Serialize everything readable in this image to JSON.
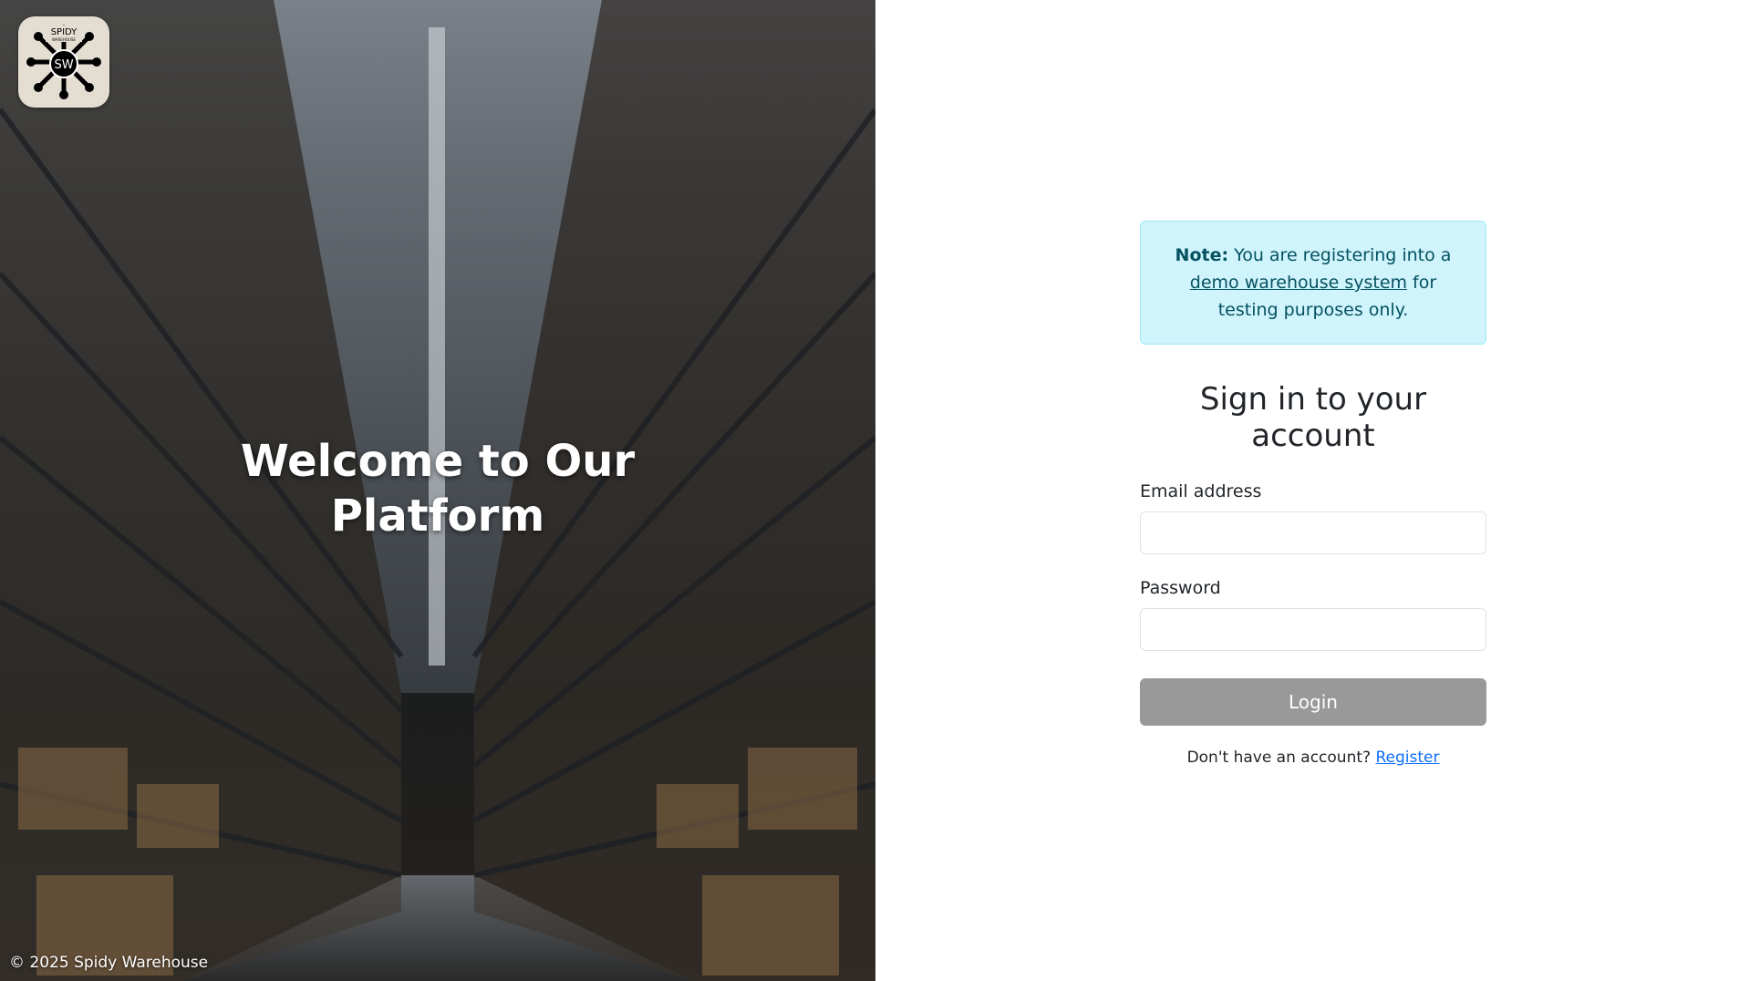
{
  "hero": {
    "logo_top_text": "SPIDY",
    "logo_small_text": "WAREHOUSE",
    "logo_monogram": "SW",
    "title_line1": "Welcome to Our",
    "title_line2": "Platform",
    "copyright": "© 2025 Spidy Warehouse"
  },
  "note": {
    "label": "Note:",
    "text_before": " You are registering into a ",
    "link_text": "demo warehouse system",
    "text_after": " for testing purposes only."
  },
  "form": {
    "heading": "Sign in to your account",
    "email_label": "Email address",
    "email_value": "",
    "password_label": "Password",
    "password_value": "",
    "login_label": "Login",
    "register_prompt": "Don't have an account? ",
    "register_link": "Register"
  },
  "colors": {
    "note_bg": "#cff4fc",
    "note_text": "#055160",
    "login_bg": "#999999",
    "link": "#0d6efd"
  }
}
